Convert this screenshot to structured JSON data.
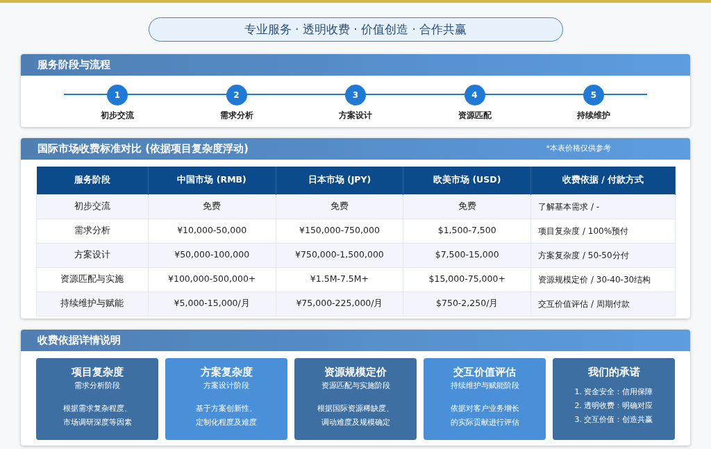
{
  "banner": "专业服务 · 透明收费 · 价值创造 · 合作共赢",
  "process": {
    "title": "服务阶段与流程",
    "steps": [
      {
        "number": "1",
        "label": "初步交流"
      },
      {
        "number": "2",
        "label": "需求分析"
      },
      {
        "number": "3",
        "label": "方案设计"
      },
      {
        "number": "4",
        "label": "资源匹配"
      },
      {
        "number": "5",
        "label": "持续维护"
      }
    ]
  },
  "pricing": {
    "title": "国际市场收费标准对比 (依据项目复杂度浮动)",
    "note": "*本表价格仅供参考",
    "columns": [
      "服务阶段",
      "中国市场 (RMB)",
      "日本市场 (JPY)",
      "欧美市场 (USD)",
      "收费依据 / 付款方式"
    ],
    "rows": [
      [
        "初步交流",
        "免费",
        "免费",
        "免费",
        "了解基本需求 / -"
      ],
      [
        "需求分析",
        "¥10,000-50,000",
        "¥150,000-750,000",
        "$1,500-7,500",
        "项目复杂度 / 100%预付"
      ],
      [
        "方案设计",
        "¥50,000-100,000",
        "¥750,000-1,500,000",
        "$7,500-15,000",
        "方案复杂度 / 50-50分付"
      ],
      [
        "资源匹配与实施",
        "¥100,000-500,000+",
        "¥1.5M-7.5M+",
        "$15,000-75,000+",
        "资源规模定价 / 30-40-30结构"
      ],
      [
        "持续维护与赋能",
        "¥5,000-15,000/月",
        "¥75,000-225,000/月",
        "$750-2,250/月",
        "交互价值评估 / 周期付款"
      ]
    ]
  },
  "details": {
    "title": "收费依据详情说明",
    "cards": [
      {
        "kind": "dark",
        "title": "项目复杂度",
        "subtitle": "需求分析阶段",
        "lines": [
          "根据需求复杂程度、",
          "市场调研深度等因素"
        ]
      },
      {
        "kind": "light",
        "title": "方案复杂度",
        "subtitle": "方案设计阶段",
        "lines": [
          "基于方案创新性、",
          "定制化程度及难度"
        ]
      },
      {
        "kind": "dark",
        "title": "资源规模定价",
        "subtitle": "资源匹配与实施阶段",
        "lines": [
          "根据国际资源稀缺度、",
          "调动难度及规模确定"
        ]
      },
      {
        "kind": "light",
        "title": "交互价值评估",
        "subtitle": "持续维护与赋能阶段",
        "lines": [
          "依据对客户业务增长",
          "的实际贡献进行评估"
        ]
      },
      {
        "kind": "dark",
        "title": "我们的承诺",
        "lines": [
          "1. 资金安全：信用保障",
          "2. 透明收费：明确对应",
          "3. 交互价值：创造共赢"
        ]
      }
    ]
  }
}
